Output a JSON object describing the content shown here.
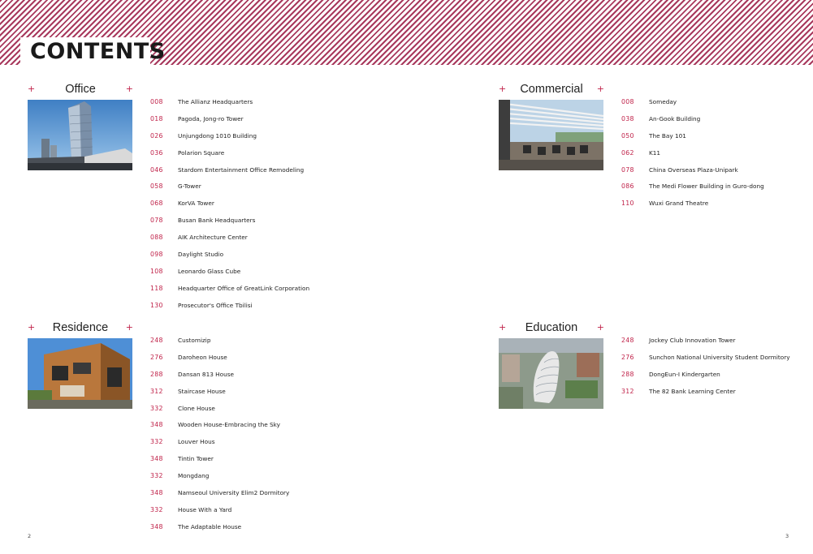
{
  "page": {
    "title": "CONTENTS",
    "page_left": "2",
    "page_right": "3"
  },
  "sections": {
    "office": {
      "title": "Office",
      "plus": "+",
      "items": [
        {
          "page": "008",
          "name": "The Allianz Headquarters"
        },
        {
          "page": "018",
          "name": "Pagoda, Jong-ro Tower"
        },
        {
          "page": "026",
          "name": "Unjungdong 1010 Building"
        },
        {
          "page": "036",
          "name": "Polarion Square"
        },
        {
          "page": "046",
          "name": "Stardom Entertainment Office Remodeling"
        },
        {
          "page": "058",
          "name": "G-Tower"
        },
        {
          "page": "068",
          "name": "KorVA Tower"
        },
        {
          "page": "078",
          "name": "Busan Bank Headquarters"
        },
        {
          "page": "088",
          "name": "AIK Architecture Center"
        },
        {
          "page": "098",
          "name": "Daylight Studio"
        },
        {
          "page": "108",
          "name": "Leonardo Glass Cube"
        },
        {
          "page": "118",
          "name": "Headquarter Office of GreatLink Corporation"
        },
        {
          "page": "130",
          "name": "Prosecutor's Office Tbilisi"
        }
      ]
    },
    "residence": {
      "title": "Residence",
      "plus": "+",
      "items": [
        {
          "page": "248",
          "name": "Customizip"
        },
        {
          "page": "276",
          "name": "Daroheon House"
        },
        {
          "page": "288",
          "name": "Dansan 813 House"
        },
        {
          "page": "312",
          "name": "Staircase House"
        },
        {
          "page": "332",
          "name": "Clone House"
        },
        {
          "page": "348",
          "name": "Wooden House-Embracing the Sky"
        },
        {
          "page": "332",
          "name": "Louver Hous"
        },
        {
          "page": "348",
          "name": "Tintin Tower"
        },
        {
          "page": "332",
          "name": "Mongdang"
        },
        {
          "page": "348",
          "name": "Namseoul University Elim2 Dormitory"
        },
        {
          "page": "332",
          "name": "House With a Yard"
        },
        {
          "page": "348",
          "name": "The Adaptable House"
        }
      ]
    },
    "commercial": {
      "title": "Commercial",
      "plus": "+",
      "items": [
        {
          "page": "008",
          "name": "Someday"
        },
        {
          "page": "038",
          "name": "An-Gook Building"
        },
        {
          "page": "050",
          "name": "The Bay 101"
        },
        {
          "page": "062",
          "name": "K11"
        },
        {
          "page": "078",
          "name": "China Overseas Plaza-Unipark"
        },
        {
          "page": "086",
          "name": "The Medi Flower Building in Guro-dong"
        },
        {
          "page": "110",
          "name": "Wuxi Grand Theatre"
        }
      ]
    },
    "education": {
      "title": "Education",
      "plus": "+",
      "items": [
        {
          "page": "248",
          "name": "Jockey Club Innovation Tower"
        },
        {
          "page": "276",
          "name": "Sunchon National University Student  Dormitory"
        },
        {
          "page": "288",
          "name": "DongEun-I Kindergarten"
        },
        {
          "page": "312",
          "name": "The 82 Bank Learning Center"
        }
      ]
    }
  },
  "colors": {
    "accent": "#c0234a",
    "stripe": "#a8395d",
    "text": "#222222"
  }
}
